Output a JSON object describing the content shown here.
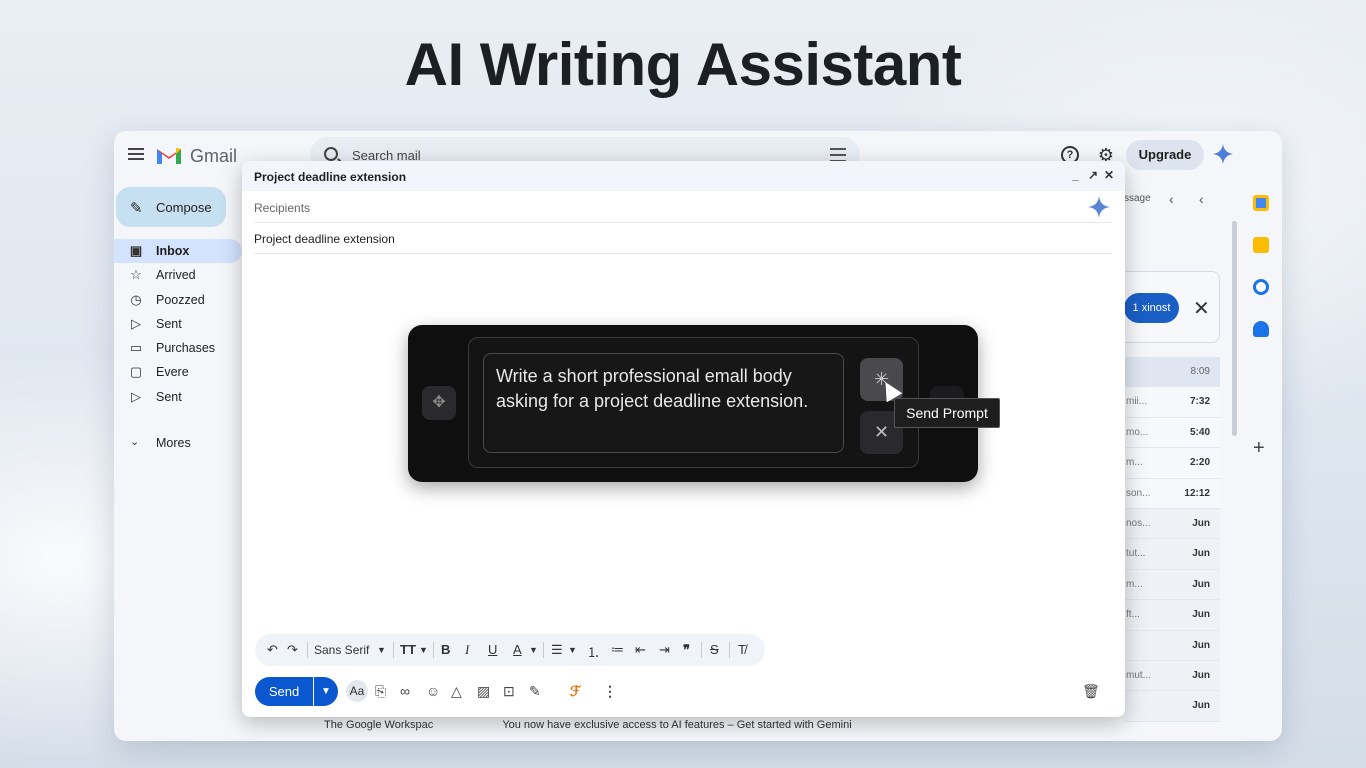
{
  "hero": {
    "title": "AI Writing Assistant"
  },
  "topbar": {
    "app_name": "Gmail",
    "search_placeholder": "Search mail",
    "upgrade_label": "Upgrade"
  },
  "sidebar": {
    "compose_label": "Compose",
    "items": [
      {
        "label": "Inbox",
        "icon": "inbox-icon"
      },
      {
        "label": "Arrived",
        "icon": "star-icon"
      },
      {
        "label": "Poozzed",
        "icon": "clock-icon"
      },
      {
        "label": "Sent",
        "icon": "send-icon"
      },
      {
        "label": "Purchases",
        "icon": "label-icon"
      },
      {
        "label": "Evere",
        "icon": "folder-icon"
      },
      {
        "label": "Sent",
        "icon": "send-icon"
      }
    ],
    "more_label": "Mores"
  },
  "mail_list": {
    "toolbar_text": "ssage",
    "notice_button": "1 xinost",
    "rows": [
      {
        "snippet": "",
        "time": "8:09"
      },
      {
        "snippet": "mii...",
        "time": "7:32"
      },
      {
        "snippet": "mo...",
        "time": "5:40"
      },
      {
        "snippet": "m...",
        "time": "2:20"
      },
      {
        "snippet": "son...",
        "time": "12:12"
      },
      {
        "snippet": "nos...",
        "time": "Jun"
      },
      {
        "snippet": "tut...",
        "time": "Jun"
      },
      {
        "snippet": "m...",
        "time": "Jun"
      },
      {
        "snippet": "ft...",
        "time": "Jun"
      },
      {
        "snippet": "",
        "time": "Jun"
      },
      {
        "snippet": "mut...",
        "time": "Jun"
      },
      {
        "snippet": "",
        "time": "Jun"
      }
    ],
    "bottom_sender": "The Google Workspac",
    "bottom_subject": "You now have exclusive access to AI features – Get started with Gemini"
  },
  "compose": {
    "title": "Project deadline extension",
    "recipients_placeholder": "Recipients",
    "subject": "Project deadline extension",
    "ctl_minimize": "_",
    "ctl_expand": "↗",
    "ctl_close": "✕"
  },
  "ai_prompt": {
    "text": "Write a short professional emall body asking for a project deadline extension.",
    "tooltip": "Send Prompt"
  },
  "format_toolbar": {
    "font": "Sans Serif"
  },
  "bottom_bar": {
    "send_label": "Send",
    "aa_label": "Aa"
  },
  "colors": {
    "accent": "#0b57d0",
    "compose_bg": "#c6e0f2",
    "active_nav": "#d3e2fd",
    "ai_panel": "#0f0f10"
  }
}
